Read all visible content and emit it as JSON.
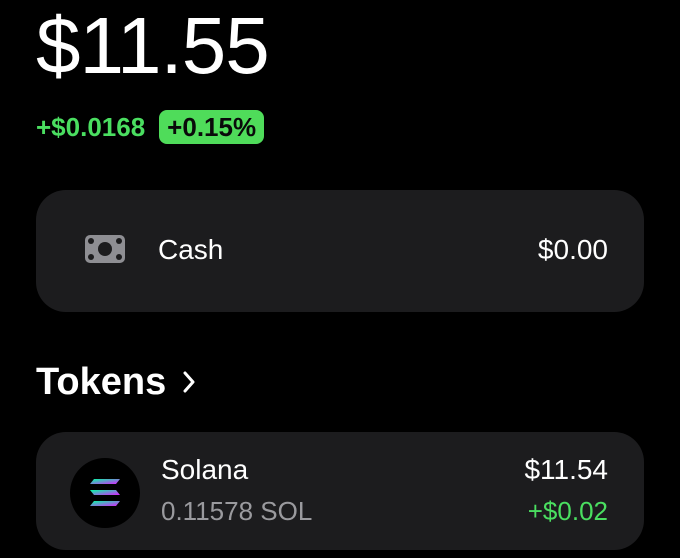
{
  "portfolio": {
    "balance": "$11.55",
    "change_amount": "+$0.0168",
    "change_percent": "+0.15%"
  },
  "cash": {
    "icon": "cash-icon",
    "label": "Cash",
    "value": "$0.00"
  },
  "tokens": {
    "title": "Tokens",
    "items": [
      {
        "icon": "solana-logo-icon",
        "name": "Solana",
        "amount": "0.11578 SOL",
        "value": "$11.54",
        "change": "+$0.02"
      }
    ]
  },
  "colors": {
    "background": "#000000",
    "card": "#1c1c1e",
    "positive": "#4ade60",
    "pill": "#4fdc5a",
    "secondary_text": "#9a9a9e"
  }
}
